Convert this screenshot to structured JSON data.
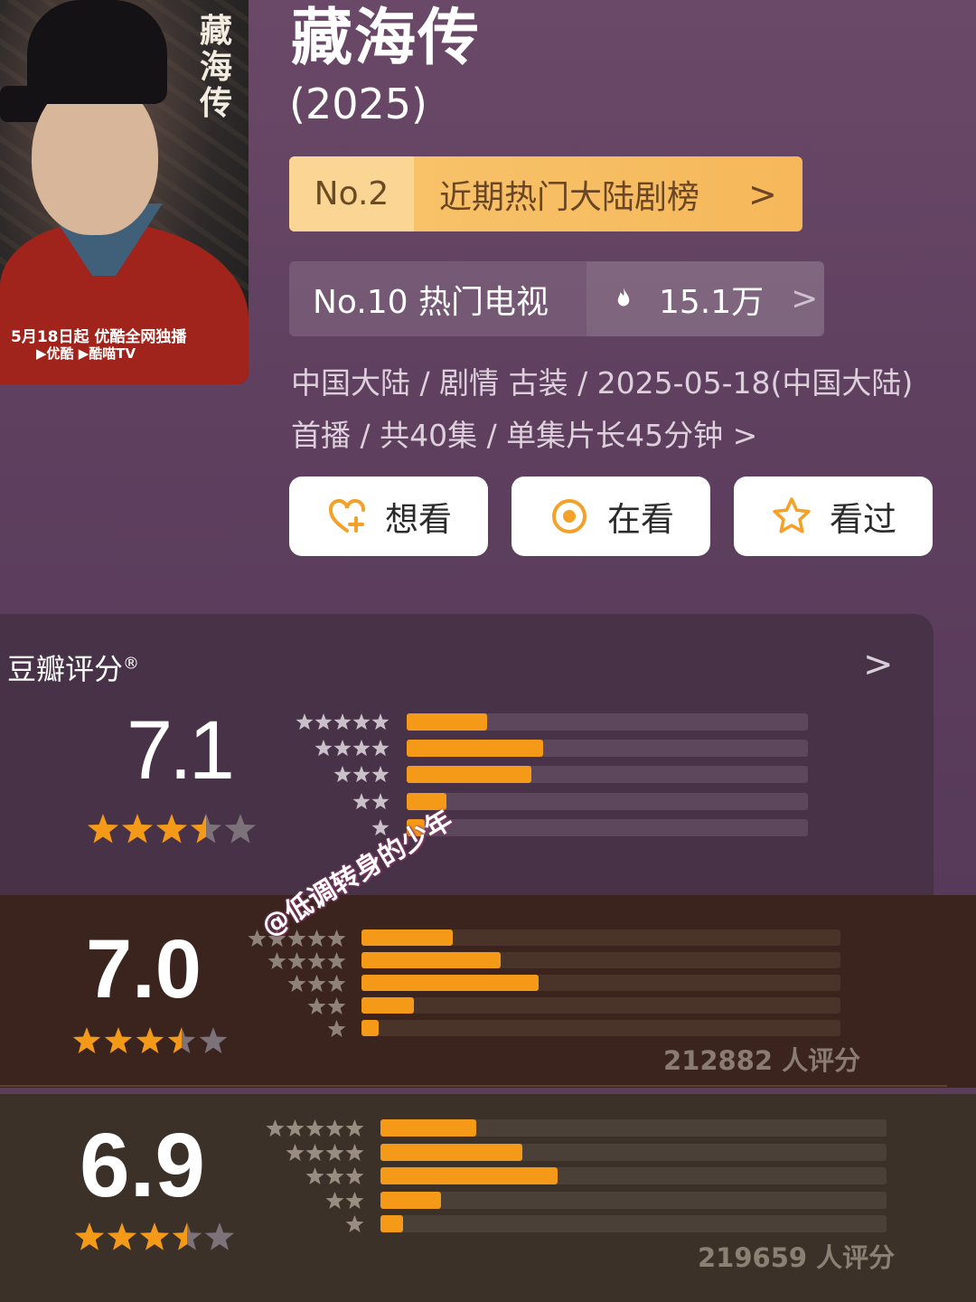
{
  "poster": {
    "title_calligraphy": "藏海传",
    "release_text": "5月18日起 优酷全网独播",
    "platforms": "▶优酷 ▶酷喵TV"
  },
  "show": {
    "title": "藏海传",
    "year": "(2025)"
  },
  "rank_primary": {
    "no": "No.2",
    "label": "近期热门大陆剧榜",
    "chevron": ">"
  },
  "rank_secondary": {
    "label": "No.10 热门电视",
    "heat": "15.1万",
    "chevron": ">"
  },
  "meta": {
    "line1": "中国大陆 / 剧情 古装 / 2025-05-18(中国大陆)",
    "line2": "首播 / 共40集 / 单集片长45分钟 >"
  },
  "actions": [
    {
      "label": "想看",
      "icon": "heart-plus-icon"
    },
    {
      "label": "在看",
      "icon": "circle-dot-icon"
    },
    {
      "label": "看过",
      "icon": "star-outline-icon"
    }
  ],
  "rating_panel": {
    "title": "豆瓣评分",
    "registered_mark": "®",
    "chevron": ">"
  },
  "ratings": [
    {
      "score": "7.1",
      "stars_filled": 3.5,
      "distribution": [
        0.2,
        0.34,
        0.31,
        0.1,
        0.045
      ],
      "count": ""
    },
    {
      "score": "7.0",
      "stars_filled": 3.5,
      "distribution": [
        0.19,
        0.29,
        0.37,
        0.11,
        0.035
      ],
      "count": "212882 人评分"
    },
    {
      "score": "6.9",
      "stars_filled": 3.5,
      "distribution": [
        0.19,
        0.28,
        0.35,
        0.12,
        0.045
      ],
      "count": "219659 人评分"
    }
  ],
  "watermark": "@低调转身的少年",
  "colors": {
    "accent_orange": "#f49a18",
    "rank_gold": "#f6b85a",
    "background_purple": "#5a3d5c"
  }
}
